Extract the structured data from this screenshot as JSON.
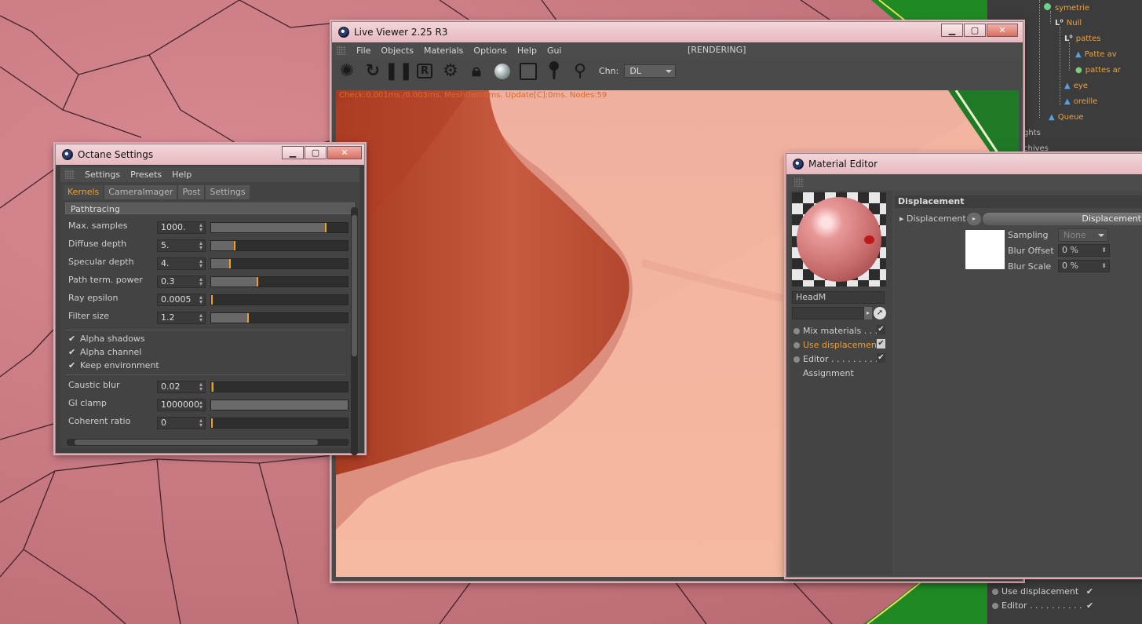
{
  "object_manager": {
    "items": [
      {
        "label": "symetrie"
      },
      {
        "label": "Null"
      },
      {
        "label": "pattes"
      },
      {
        "label": "Patte av"
      },
      {
        "label": "pattes ar"
      },
      {
        "label": "eye"
      },
      {
        "label": "oreille"
      },
      {
        "label": "Queue"
      }
    ],
    "tab_partial_1": "ghts",
    "tab_partial_2": "chives"
  },
  "attributes_bottom": {
    "use_displacement": "Use displacement",
    "editor": "Editor . . . . . . . . . .",
    "check": "✔"
  },
  "live_viewer": {
    "title": "Live Viewer 2.25 R3",
    "menu": [
      "File",
      "Objects",
      "Materials",
      "Options",
      "Help",
      "Gui"
    ],
    "state": "[RENDERING]",
    "channel_label": "Chn:",
    "channel_value": "DL",
    "status": "Check:0.001ms./0.003ms. MeshGen:0ms. Update[C]:0ms. Nodes:59",
    "toolbar_icons": [
      "octane-logo-icon",
      "restart-icon",
      "pause-icon",
      "region-render-icon",
      "settings-gear-icon",
      "lock-icon",
      "material-preview-icon",
      "clay-mode-icon",
      "focus-picker-icon",
      "material-picker-icon"
    ]
  },
  "octane_settings": {
    "title": "Octane Settings",
    "menu": [
      "Settings",
      "Presets",
      "Help"
    ],
    "tabs": [
      "Kernels",
      "CameraImager",
      "Post",
      "Settings"
    ],
    "active_tab": "Kernels",
    "section": "Pathtracing",
    "params": [
      {
        "label": "Max. samples",
        "value": "1000.",
        "fraction": 0.84
      },
      {
        "label": "Diffuse depth",
        "value": "5.",
        "fraction": 0.17
      },
      {
        "label": "Specular depth",
        "value": "4.",
        "fraction": 0.14
      },
      {
        "label": "Path term. power",
        "value": "0.3",
        "fraction": 0.34
      },
      {
        "label": "Ray epsilon",
        "value": "0.0005",
        "fraction": 0.0
      },
      {
        "label": "Filter size",
        "value": "1.2",
        "fraction": 0.27
      }
    ],
    "checks": [
      {
        "label": "Alpha shadows",
        "checked": true
      },
      {
        "label": "Alpha channel",
        "checked": true
      },
      {
        "label": "Keep environment",
        "checked": true
      }
    ],
    "params2": [
      {
        "label": "Caustic blur",
        "value": "0.02",
        "fraction": 0.01
      },
      {
        "label": "GI clamp",
        "value": "1000000.",
        "fraction": 1.0
      },
      {
        "label": "Coherent ratio",
        "value": "0",
        "fraction": 0.0
      }
    ],
    "check_glyph": "✔"
  },
  "material_editor": {
    "title": "Material Editor",
    "material_name": "HeadM",
    "channels": [
      {
        "label": "Mix materials . . . .",
        "checked": true,
        "active": false
      },
      {
        "label": "Use displacement",
        "checked": true,
        "active": true
      },
      {
        "label": "Editor . . . . . . . . . .",
        "checked": true,
        "active": false
      }
    ],
    "assignment": "Assignment",
    "section": "Displacement",
    "displacement_label": "Displacement",
    "displacement_button": "Displacement",
    "sampling_label": "Sampling",
    "sampling_value": "None",
    "blur_offset_label": "Blur Offset",
    "blur_offset_value": "0 %",
    "blur_scale_label": "Blur Scale",
    "blur_scale_value": "0 %",
    "check_glyph": "✔",
    "colors": {
      "active": "#f1a02a"
    }
  },
  "window_controls": {
    "minimize": "▁",
    "maximize": "▢",
    "close": "✕"
  }
}
